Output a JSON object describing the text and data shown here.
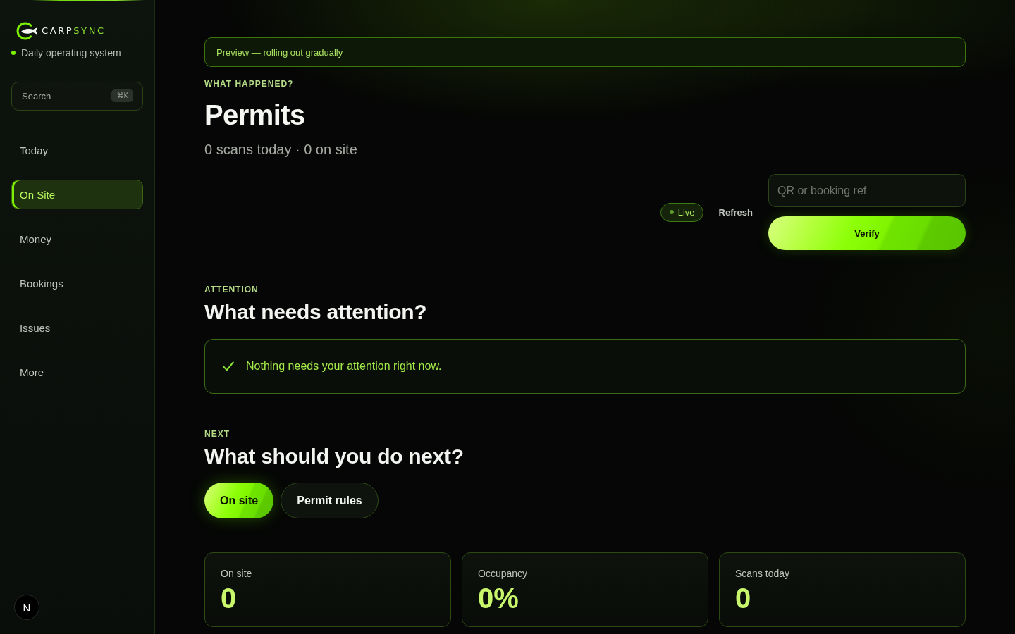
{
  "sidebar": {
    "logo": {
      "primary": "CARP",
      "accent": "SYNC"
    },
    "tagline": "Daily operating system",
    "search": {
      "placeholder": "Search",
      "shortcut": "⌘K"
    },
    "nav": [
      {
        "label": "Today",
        "selected": false
      },
      {
        "label": "On Site",
        "selected": true
      },
      {
        "label": "Money",
        "selected": false
      },
      {
        "label": "Bookings",
        "selected": false
      },
      {
        "label": "Issues",
        "selected": false
      },
      {
        "label": "More",
        "selected": false
      }
    ],
    "dev_tools": "N"
  },
  "banner": "Preview — rolling out gradually",
  "header": {
    "eyebrow": "WHAT HAPPENED?",
    "title": "Permits",
    "summary": "0 scans today · 0 on site"
  },
  "controls": {
    "live": "Live",
    "refresh": "Refresh",
    "lookup": {
      "placeholder": "QR or booking ref"
    },
    "verify": "Verify"
  },
  "attention": {
    "eyebrow": "ATTENTION",
    "title": "What needs attention?",
    "message": "Nothing needs your attention right now."
  },
  "next": {
    "eyebrow": "NEXT",
    "title": "What should you do next?",
    "actions": [
      {
        "label": "On site",
        "kind": "primary"
      },
      {
        "label": "Permit rules",
        "kind": "secondary"
      }
    ]
  },
  "stats": [
    {
      "label": "On site",
      "value": "0"
    },
    {
      "label": "Occupancy",
      "value": "0%"
    },
    {
      "label": "Scans today",
      "value": "0"
    }
  ]
}
